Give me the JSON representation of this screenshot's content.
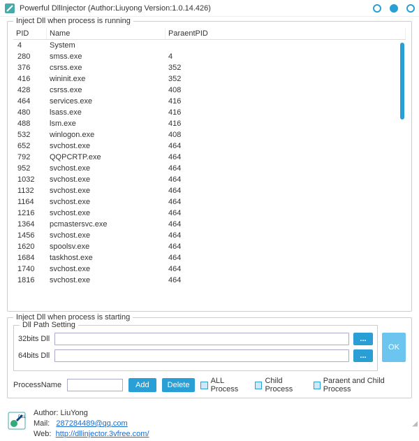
{
  "window": {
    "title": "Powerful DllInjector (Author:Liuyong Version:1.0.14.426)"
  },
  "group1": {
    "title": "Inject Dll when process is running"
  },
  "table": {
    "headers": {
      "pid": "PID",
      "name": "Name",
      "ppid": "ParaentPID"
    },
    "rows": [
      {
        "pid": "4",
        "name": "System",
        "ppid": ""
      },
      {
        "pid": "280",
        "name": "smss.exe",
        "ppid": "4"
      },
      {
        "pid": "376",
        "name": "csrss.exe",
        "ppid": "352"
      },
      {
        "pid": "416",
        "name": "wininit.exe",
        "ppid": "352"
      },
      {
        "pid": "428",
        "name": "csrss.exe",
        "ppid": "408"
      },
      {
        "pid": "464",
        "name": "services.exe",
        "ppid": "416"
      },
      {
        "pid": "480",
        "name": "lsass.exe",
        "ppid": "416"
      },
      {
        "pid": "488",
        "name": "lsm.exe",
        "ppid": "416"
      },
      {
        "pid": "532",
        "name": "winlogon.exe",
        "ppid": "408"
      },
      {
        "pid": "652",
        "name": "svchost.exe",
        "ppid": "464"
      },
      {
        "pid": "792",
        "name": "QQPCRTP.exe",
        "ppid": "464"
      },
      {
        "pid": "952",
        "name": "svchost.exe",
        "ppid": "464"
      },
      {
        "pid": "1032",
        "name": "svchost.exe",
        "ppid": "464"
      },
      {
        "pid": "1132",
        "name": "svchost.exe",
        "ppid": "464"
      },
      {
        "pid": "1164",
        "name": "svchost.exe",
        "ppid": "464"
      },
      {
        "pid": "1216",
        "name": "svchost.exe",
        "ppid": "464"
      },
      {
        "pid": "1364",
        "name": "pcmastersvc.exe",
        "ppid": "464"
      },
      {
        "pid": "1456",
        "name": "svchost.exe",
        "ppid": "464"
      },
      {
        "pid": "1620",
        "name": "spoolsv.exe",
        "ppid": "464"
      },
      {
        "pid": "1684",
        "name": "taskhost.exe",
        "ppid": "464"
      },
      {
        "pid": "1740",
        "name": "svchost.exe",
        "ppid": "464"
      },
      {
        "pid": "1816",
        "name": "svchost.exe",
        "ppid": "464"
      }
    ]
  },
  "group2": {
    "title": "Inject Dll when process is starting"
  },
  "dllpath": {
    "title": "Dll Path Setting",
    "label32": "32bits Dll",
    "label64": "64bits Dll",
    "value32": "",
    "value64": "",
    "browse": "...",
    "ok": "OK"
  },
  "procrow": {
    "label": "ProcessName",
    "value": "",
    "add": "Add",
    "del": "Delete",
    "chk_all": "ALL Process",
    "chk_child": "Child Process",
    "chk_parent": "Paraent and Child Process"
  },
  "footer": {
    "author_label": "Author:",
    "author": "LiuYong",
    "mail_label": "Mail:",
    "mail": "287284489@qq.com",
    "web_label": "Web:",
    "web": "http://dllinjector.3vfree.com/"
  }
}
